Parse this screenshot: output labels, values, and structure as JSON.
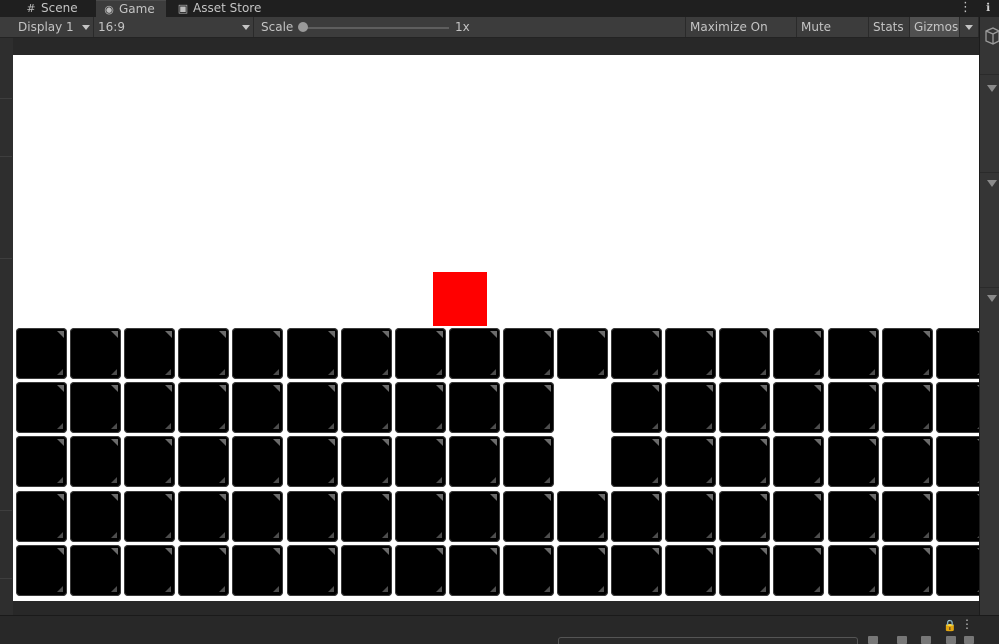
{
  "tabs": [
    {
      "label": "Scene",
      "icon": "hash-icon"
    },
    {
      "label": "Game",
      "icon": "gamepad-icon"
    },
    {
      "label": "Asset Store",
      "icon": "shopping-bag-icon"
    }
  ],
  "toolbar": {
    "display": "Display 1",
    "aspect": "16:9",
    "scale_label": "Scale",
    "scale_value": "1x",
    "maximize": "Maximize On Play",
    "mute": "Mute Audio",
    "stats": "Stats",
    "gizmos": "Gizmos"
  },
  "colors": {
    "player": "#ff0000",
    "tile": "#000000",
    "background": "#ffffff",
    "editor_bg": "#282828"
  },
  "game_scene": {
    "player": "red-square",
    "tile_columns": 18,
    "tile_rows": 5,
    "gap": {
      "column": 10,
      "missing_rows": [
        1,
        2
      ]
    }
  }
}
